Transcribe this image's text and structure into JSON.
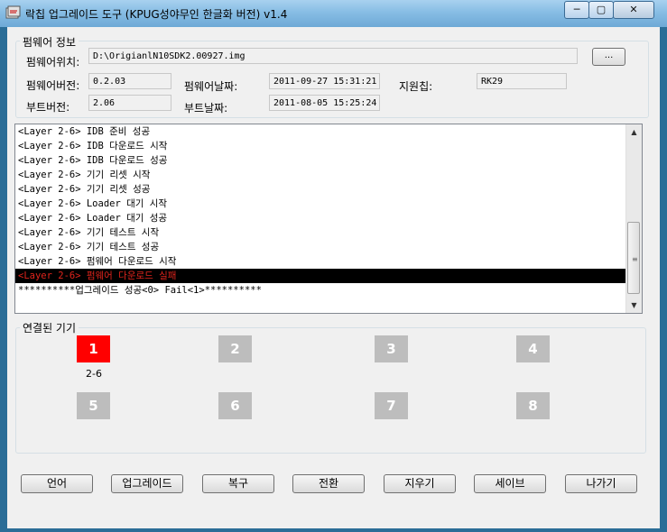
{
  "window": {
    "title": "락칩 업그레이드 도구 (KPUG성야무인 한글화 버전) v1.4",
    "minimize": "─",
    "maximize": "▢",
    "close": "✕"
  },
  "firmware": {
    "group_title": "펌웨어 정보",
    "location_label": "펌웨어위치:",
    "location_value": "D:\\OrigianlN10SDK2.00927.img",
    "browse_label": "...",
    "version_label": "펌웨어버전:",
    "version_value": "0.2.03",
    "date_label": "펌웨어날짜:",
    "date_value": "2011-09-27 15:31:21",
    "chip_label": "지원칩:",
    "chip_value": "RK29",
    "boot_version_label": "부트버전:",
    "boot_version_value": "2.06",
    "boot_date_label": "부트날짜:",
    "boot_date_value": "2011-08-05 15:25:24"
  },
  "log": {
    "lines": [
      "<Layer 2-6> IDB 준비 성공",
      "<Layer 2-6> IDB 다운로드 시작",
      "<Layer 2-6> IDB 다운로드 성공",
      "<Layer 2-6> 기기 리셋 시작",
      "<Layer 2-6> 기기 리셋 성공",
      "<Layer 2-6> Loader 대기 시작",
      "<Layer 2-6> Loader 대기 성공",
      "<Layer 2-6> 기기 테스트 시작",
      "<Layer 2-6> 기기 테스트 성공",
      "<Layer 2-6> 펌웨어 다운로드 시작",
      "<Layer 2-6> 펌웨어 다운로드 실패",
      "**********업그레이드 성공<0> Fail<1>**********"
    ],
    "selected_index": 10,
    "up_arrow": "▲",
    "down_arrow": "▼",
    "grip": "≡"
  },
  "devices": {
    "group_title": "연결된 기기",
    "slots": [
      {
        "number": "1",
        "active": true,
        "sub": "2-6"
      },
      {
        "number": "2",
        "active": false,
        "sub": ""
      },
      {
        "number": "3",
        "active": false,
        "sub": ""
      },
      {
        "number": "4",
        "active": false,
        "sub": ""
      },
      {
        "number": "5",
        "active": false,
        "sub": ""
      },
      {
        "number": "6",
        "active": false,
        "sub": ""
      },
      {
        "number": "7",
        "active": false,
        "sub": ""
      },
      {
        "number": "8",
        "active": false,
        "sub": ""
      }
    ]
  },
  "buttons": {
    "language": "언어",
    "upgrade": "업그레이드",
    "restore": "복구",
    "switch": "전환",
    "erase": "지우기",
    "save": "세이브",
    "exit": "나가기"
  },
  "colors": {
    "active_device": "#ff0000",
    "inactive_device": "#bdbdbd",
    "error_text": "#e0241c"
  }
}
